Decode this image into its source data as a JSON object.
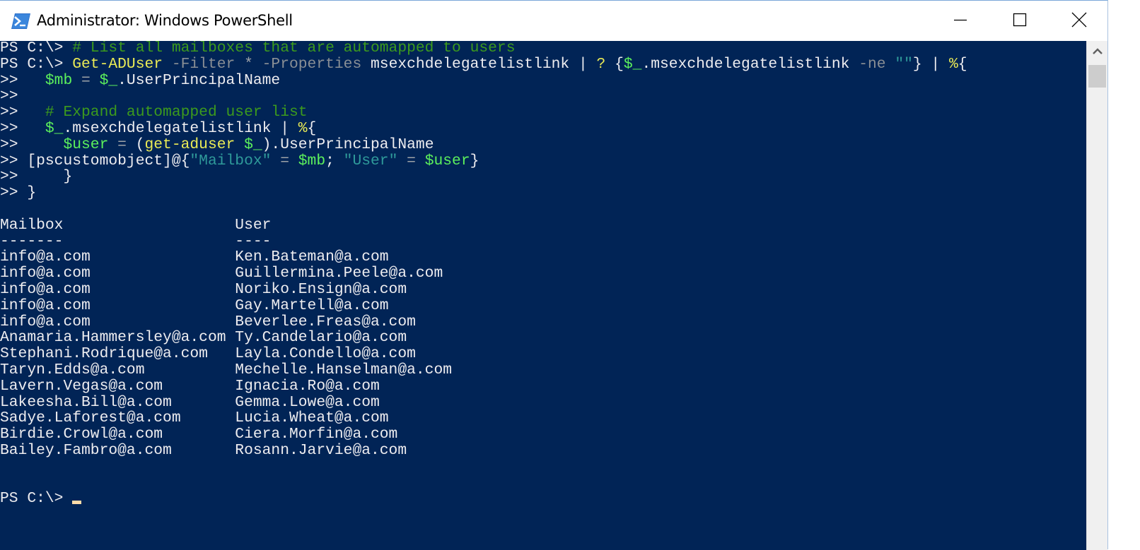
{
  "window": {
    "title": "Administrator: Windows PowerShell",
    "icon": "powershell-icon",
    "controls": {
      "minimize": "minimize-icon",
      "maximize": "maximize-icon",
      "close": "close-icon"
    }
  },
  "colors": {
    "console_bg": "#012456",
    "comment": "#3c9a1d",
    "command": "#ebeb55",
    "parameter": "#8a8f95",
    "variable": "#5cf05c",
    "string": "#2f9a9a",
    "text": "#eeedf0",
    "cursor": "#fedba9"
  },
  "console": {
    "lines": [
      [
        [
          "PS C:\\> ",
          "plain"
        ],
        [
          "# List all mailboxes that are automapped to users",
          "comment"
        ]
      ],
      [
        [
          "PS C:\\> ",
          "plain"
        ],
        [
          "Get-ADUser",
          "cmd"
        ],
        [
          " -Filter",
          "param"
        ],
        [
          " * ",
          "op"
        ],
        [
          "-Properties",
          "param"
        ],
        [
          " msexchdelegatelistlink | ",
          "plain"
        ],
        [
          "?",
          "cmd"
        ],
        [
          " {",
          "plain"
        ],
        [
          "$_",
          "var"
        ],
        [
          ".msexchdelegatelistlink ",
          "plain"
        ],
        [
          "-ne",
          "param"
        ],
        [
          " ",
          "plain"
        ],
        [
          "\"\"",
          "str"
        ],
        [
          "} | ",
          "plain"
        ],
        [
          "%",
          "cmd"
        ],
        [
          "{",
          "plain"
        ]
      ],
      [
        [
          ">>   ",
          "plain"
        ],
        [
          "$mb",
          "var"
        ],
        [
          " = ",
          "op"
        ],
        [
          "$_",
          "var"
        ],
        [
          ".UserPrincipalName",
          "plain"
        ]
      ],
      [
        [
          ">>",
          "plain"
        ]
      ],
      [
        [
          ">>   ",
          "plain"
        ],
        [
          "# Expand automapped user list",
          "comment"
        ]
      ],
      [
        [
          ">>   ",
          "plain"
        ],
        [
          "$_",
          "var"
        ],
        [
          ".msexchdelegatelistlink | ",
          "plain"
        ],
        [
          "%",
          "cmd"
        ],
        [
          "{",
          "plain"
        ]
      ],
      [
        [
          ">>     ",
          "plain"
        ],
        [
          "$user",
          "var"
        ],
        [
          " = ",
          "op"
        ],
        [
          "(",
          "plain"
        ],
        [
          "get-aduser",
          "cmd"
        ],
        [
          " ",
          "plain"
        ],
        [
          "$_",
          "var"
        ],
        [
          ").UserPrincipalName",
          "plain"
        ]
      ],
      [
        [
          ">> [pscustomobject]@{",
          "plain"
        ],
        [
          "\"Mailbox\"",
          "str"
        ],
        [
          " = ",
          "op"
        ],
        [
          "$mb",
          "var"
        ],
        [
          "; ",
          "plain"
        ],
        [
          "\"User\"",
          "str"
        ],
        [
          " = ",
          "op"
        ],
        [
          "$user",
          "var"
        ],
        [
          "}",
          "plain"
        ]
      ],
      [
        [
          ">>     }",
          "plain"
        ]
      ],
      [
        [
          ">> }",
          "plain"
        ]
      ]
    ],
    "table": {
      "headers": [
        "Mailbox",
        "User"
      ],
      "underlines": [
        "-------",
        "----"
      ],
      "rows": [
        [
          "info@a.com",
          "Ken.Bateman@a.com"
        ],
        [
          "info@a.com",
          "Guillermina.Peele@a.com"
        ],
        [
          "info@a.com",
          "Noriko.Ensign@a.com"
        ],
        [
          "info@a.com",
          "Gay.Martell@a.com"
        ],
        [
          "info@a.com",
          "Beverlee.Freas@a.com"
        ],
        [
          "Anamaria.Hammersley@a.com",
          "Ty.Candelario@a.com"
        ],
        [
          "Stephani.Rodrique@a.com",
          "Layla.Condello@a.com"
        ],
        [
          "Taryn.Edds@a.com",
          "Mechelle.Hanselman@a.com"
        ],
        [
          "Lavern.Vegas@a.com",
          "Ignacia.Ro@a.com"
        ],
        [
          "Lakeesha.Bill@a.com",
          "Gemma.Lowe@a.com"
        ],
        [
          "Sadye.Laforest@a.com",
          "Lucia.Wheat@a.com"
        ],
        [
          "Birdie.Crowl@a.com",
          "Ciera.Morfin@a.com"
        ],
        [
          "Bailey.Fambro@a.com",
          "Rosann.Jarvie@a.com"
        ]
      ]
    },
    "prompt": "PS C:\\> "
  },
  "scrollbar": {
    "up_icon": "chevron-up-icon"
  }
}
